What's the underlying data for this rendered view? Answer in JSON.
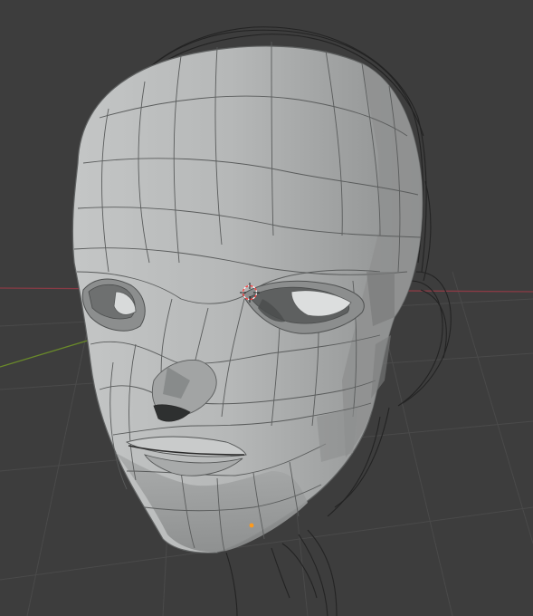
{
  "viewport": {
    "background_color": "#3d3d3d",
    "grid_color": "#4a4a4a",
    "x_axis_color": "#8a3b45",
    "y_axis_color": "#6a8a2a",
    "mesh_face_color": "#b4b6b6",
    "mesh_edge_color": "#5a5c5c",
    "reference_sketch_color": "#222222",
    "origin_color": "#ff9a1a",
    "cursor_color_a": "#ff4040",
    "cursor_color_b": "#ffffff"
  },
  "objects": {
    "mesh_name_icon": "head-mesh",
    "sketch_icon": "reference-sketch",
    "cursor_icon": "3d-cursor",
    "origin_icon": "object-origin"
  }
}
